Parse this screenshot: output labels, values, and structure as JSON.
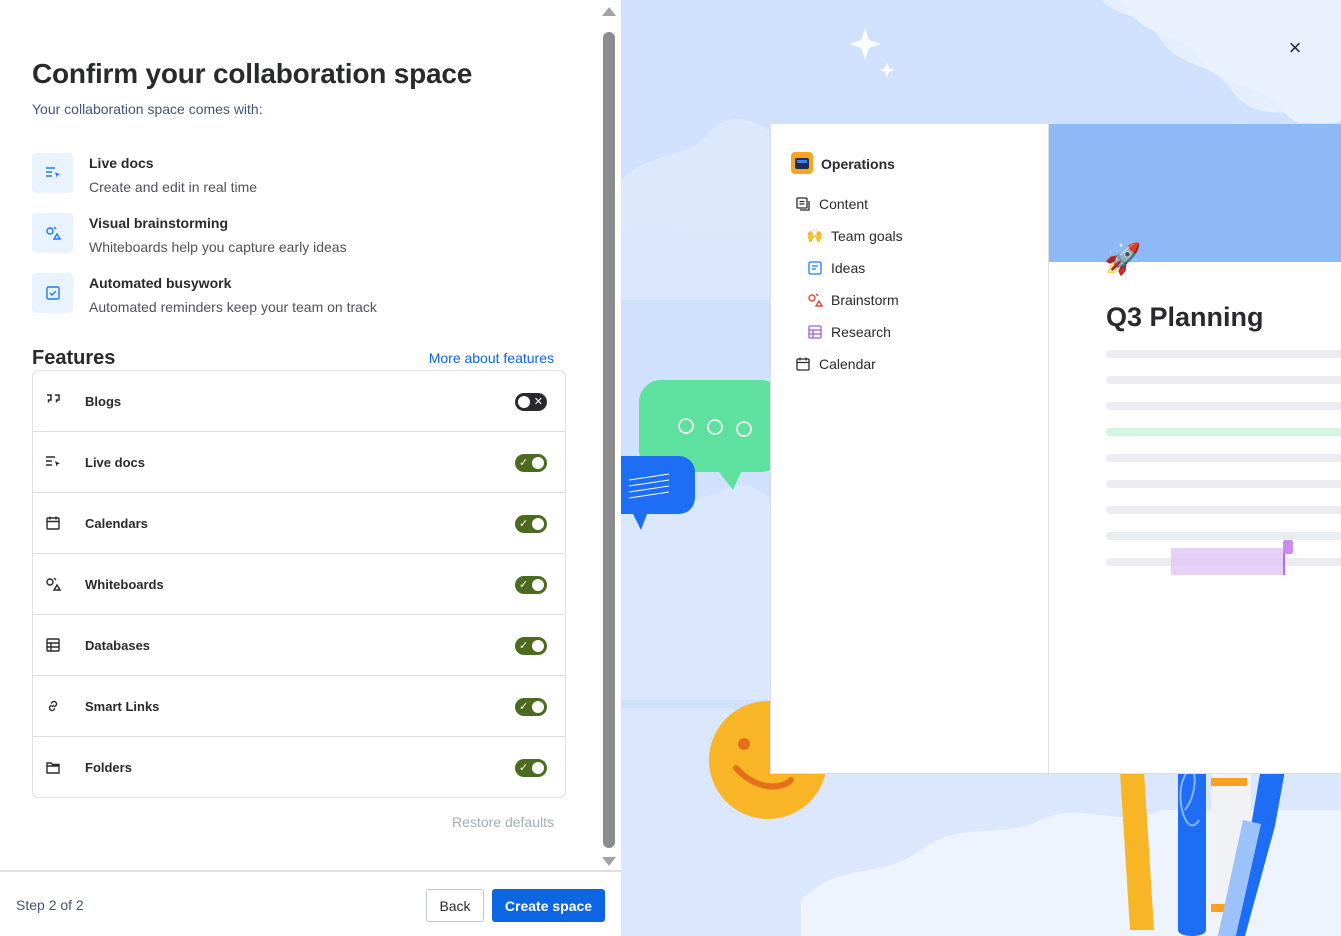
{
  "title": "Confirm your collaboration space",
  "subtitle": "Your collaboration space comes with:",
  "benefits": [
    {
      "title": "Live docs",
      "desc": "Create and edit in real time",
      "icon": "live-docs-icon"
    },
    {
      "title": "Visual brainstorming",
      "desc": "Whiteboards help you capture early ideas",
      "icon": "whiteboard-icon"
    },
    {
      "title": "Automated busywork",
      "desc": "Automated reminders keep your team on track",
      "icon": "checkbox-icon"
    }
  ],
  "features": {
    "heading": "Features",
    "more_link": "More about features",
    "items": [
      {
        "label": "Blogs",
        "icon": "quote-icon",
        "enabled": false
      },
      {
        "label": "Live docs",
        "icon": "live-docs-icon",
        "enabled": true
      },
      {
        "label": "Calendars",
        "icon": "calendar-icon",
        "enabled": true
      },
      {
        "label": "Whiteboards",
        "icon": "whiteboard-icon",
        "enabled": true
      },
      {
        "label": "Databases",
        "icon": "database-icon",
        "enabled": true
      },
      {
        "label": "Smart Links",
        "icon": "link-icon",
        "enabled": true
      },
      {
        "label": "Folders",
        "icon": "folder-icon",
        "enabled": true
      }
    ],
    "restore": "Restore defaults"
  },
  "footer": {
    "step": "Step 2 of 2",
    "back": "Back",
    "create": "Create space"
  },
  "preview": {
    "space_name": "Operations",
    "nav": [
      {
        "label": "Content",
        "icon": "content-icon"
      },
      {
        "label": "Team goals",
        "icon": "raised-hands-emoji"
      },
      {
        "label": "Ideas",
        "icon": "page-icon"
      },
      {
        "label": "Brainstorm",
        "icon": "whiteboard-icon"
      },
      {
        "label": "Research",
        "icon": "database-icon"
      },
      {
        "label": "Calendar",
        "icon": "calendar-icon"
      }
    ],
    "doc_title": "Q3 Planning",
    "doc_emoji": "🚀",
    "nav_emoji_team_goals": "🙌"
  },
  "colors": {
    "primary": "#0c66e4",
    "toggle_on": "#4c6b1f",
    "toggle_off": "#292a2e",
    "illustration_bg": "#cfe1fd"
  }
}
